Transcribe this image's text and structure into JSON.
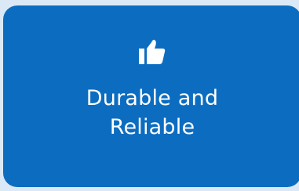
{
  "feature": {
    "icon": "thumbs-up-icon",
    "title_lines": [
      "Durable and",
      "Reliable"
    ]
  },
  "colors": {
    "background": "#dbe9f6",
    "card": "#0c6dc0",
    "text": "#ffffff",
    "icon": "#ffffff"
  }
}
